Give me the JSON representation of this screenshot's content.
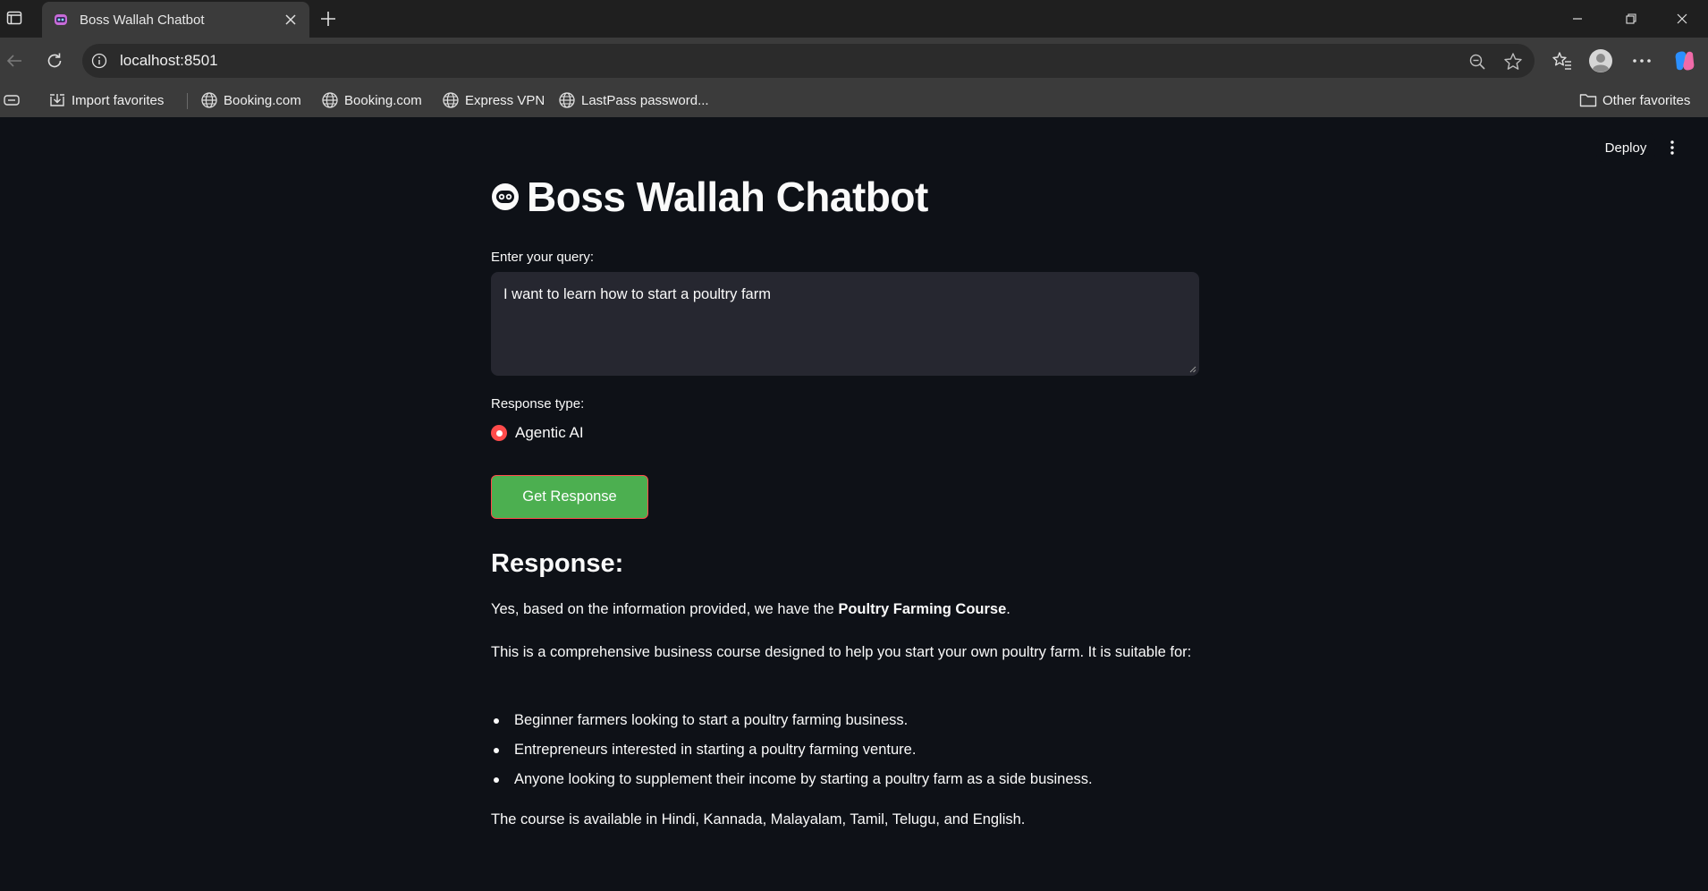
{
  "browser": {
    "tab_title": "Boss Wallah Chatbot",
    "url": "localhost:8501",
    "favorites": {
      "import": "Import favorites",
      "items": [
        "Booking.com",
        "Booking.com",
        "Express VPN",
        "LastPass password..."
      ],
      "other": "Other favorites"
    }
  },
  "app": {
    "deploy_label": "Deploy",
    "title": "Boss Wallah Chatbot",
    "query_label": "Enter your query:",
    "query_value": "I want to learn how to start a poultry farm",
    "response_type_label": "Response type:",
    "response_type_option": "Agentic AI",
    "submit_label": "Get Response",
    "response_heading": "Response:",
    "response": {
      "intro_prefix": "Yes, based on the information provided, we have the ",
      "intro_bold": "Poultry Farming Course",
      "intro_suffix": ".",
      "description": "This is a comprehensive business course designed to help you start your own poultry farm. It is suitable for:",
      "bullets": [
        "Beginner farmers looking to start a poultry farming business.",
        "Entrepreneurs interested in starting a poultry farming venture.",
        "Anyone looking to supplement their income by starting a poultry farm as a side business."
      ],
      "languages": "The course is available in Hindi, Kannada, Malayalam, Tamil, Telugu, and English."
    }
  },
  "colors": {
    "accent_red": "#ff4b4b",
    "button_green": "#4caf50",
    "app_bg": "#0e1117",
    "input_bg": "#262730"
  },
  "icons": [
    "sidebar-toggle-icon",
    "robot-icon",
    "close-icon",
    "plus-icon",
    "back-arrow-icon",
    "refresh-icon",
    "info-icon",
    "zoom-icon",
    "star-icon",
    "favorites-icon",
    "profile-icon",
    "more-icon",
    "copilot-icon",
    "globe-icon",
    "folder-icon",
    "kebab-menu-icon"
  ]
}
